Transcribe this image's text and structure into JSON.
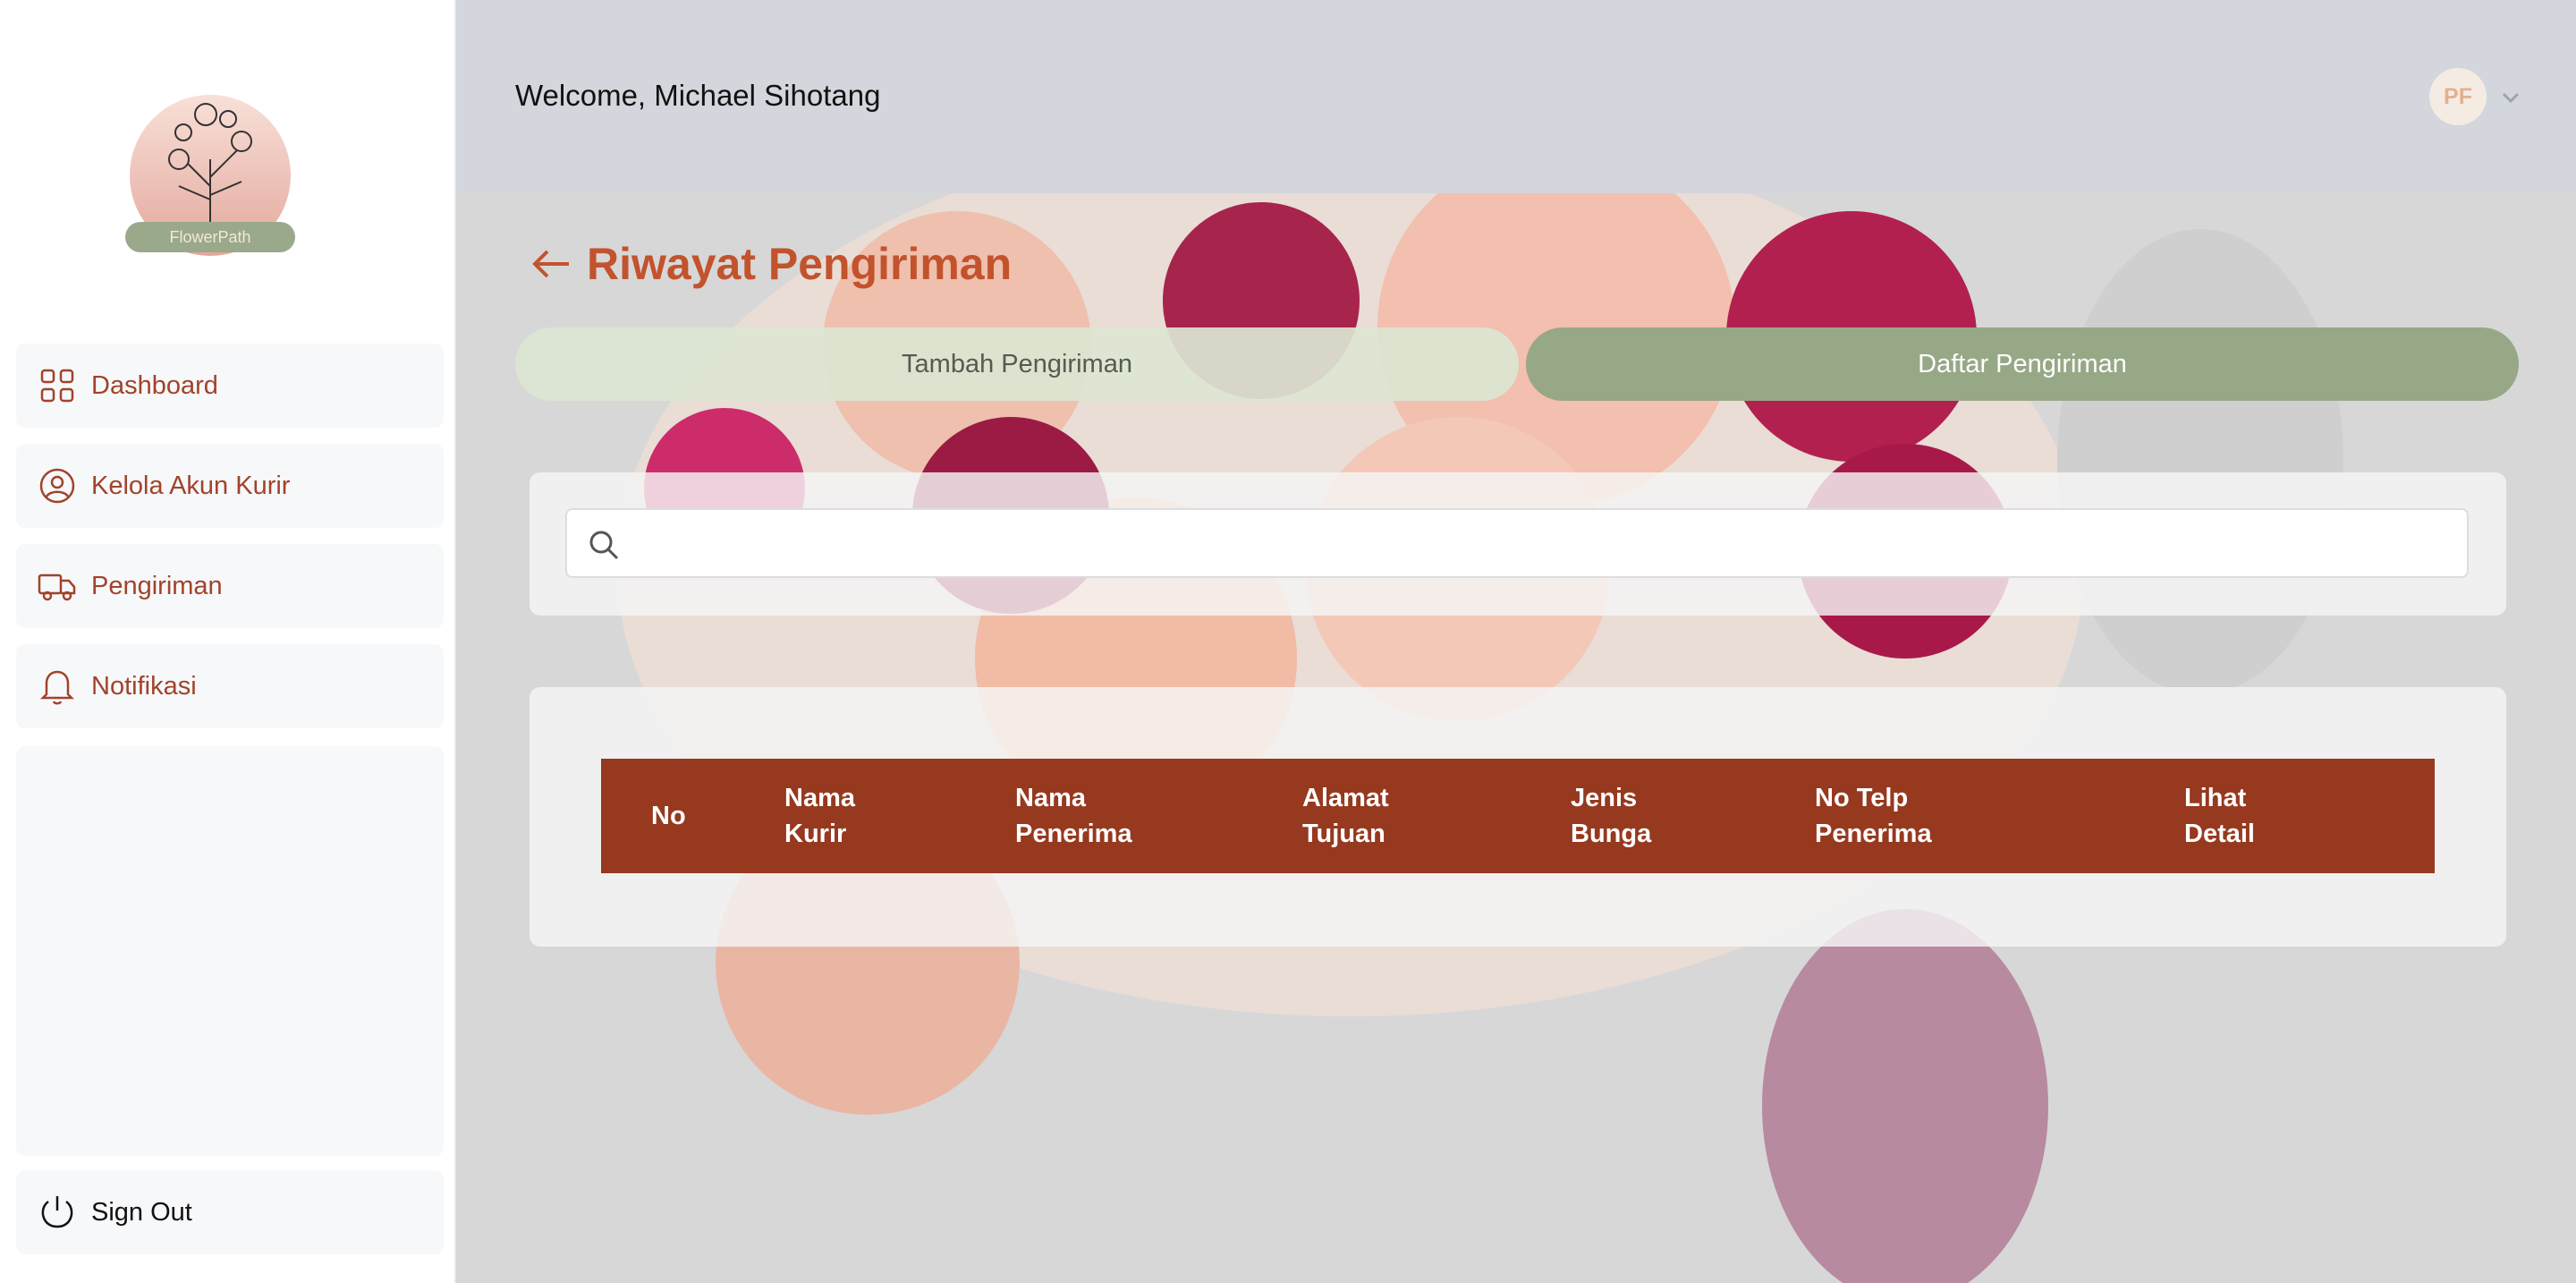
{
  "brand": {
    "logo_text": "FlowerPath"
  },
  "sidebar": {
    "items": [
      {
        "label": "Dashboard",
        "icon": "dashboard-grid-icon"
      },
      {
        "label": "Kelola Akun Kurir",
        "icon": "user-circle-icon"
      },
      {
        "label": "Pengiriman",
        "icon": "truck-icon"
      },
      {
        "label": "Notifikasi",
        "icon": "bell-icon"
      }
    ],
    "signout_label": "Sign Out"
  },
  "header": {
    "welcome": "Welcome, Michael Sihotang",
    "avatar_initials": "PF"
  },
  "main": {
    "title": "Riwayat Pengiriman",
    "tabs": [
      {
        "label": "Tambah Pengiriman",
        "active": false
      },
      {
        "label": "Daftar Pengiriman",
        "active": true
      }
    ],
    "search": {
      "placeholder": "",
      "value": ""
    },
    "table": {
      "columns": [
        {
          "line1": "No",
          "line2": ""
        },
        {
          "line1": "Nama",
          "line2": "Kurir"
        },
        {
          "line1": "Nama",
          "line2": "Penerima"
        },
        {
          "line1": "Alamat",
          "line2": "Tujuan"
        },
        {
          "line1": "Jenis",
          "line2": "Bunga"
        },
        {
          "line1": "No Telp",
          "line2": "Penerima"
        },
        {
          "line1": "Lihat",
          "line2": "Detail"
        }
      ],
      "rows": []
    }
  },
  "colors": {
    "accent": "#c2532d",
    "sidebar_text": "#a1432a",
    "table_header": "#96391f",
    "tab_active": "#97a887",
    "tab_inactive": "#dce6d2",
    "header_bg": "#d3d6dc"
  }
}
